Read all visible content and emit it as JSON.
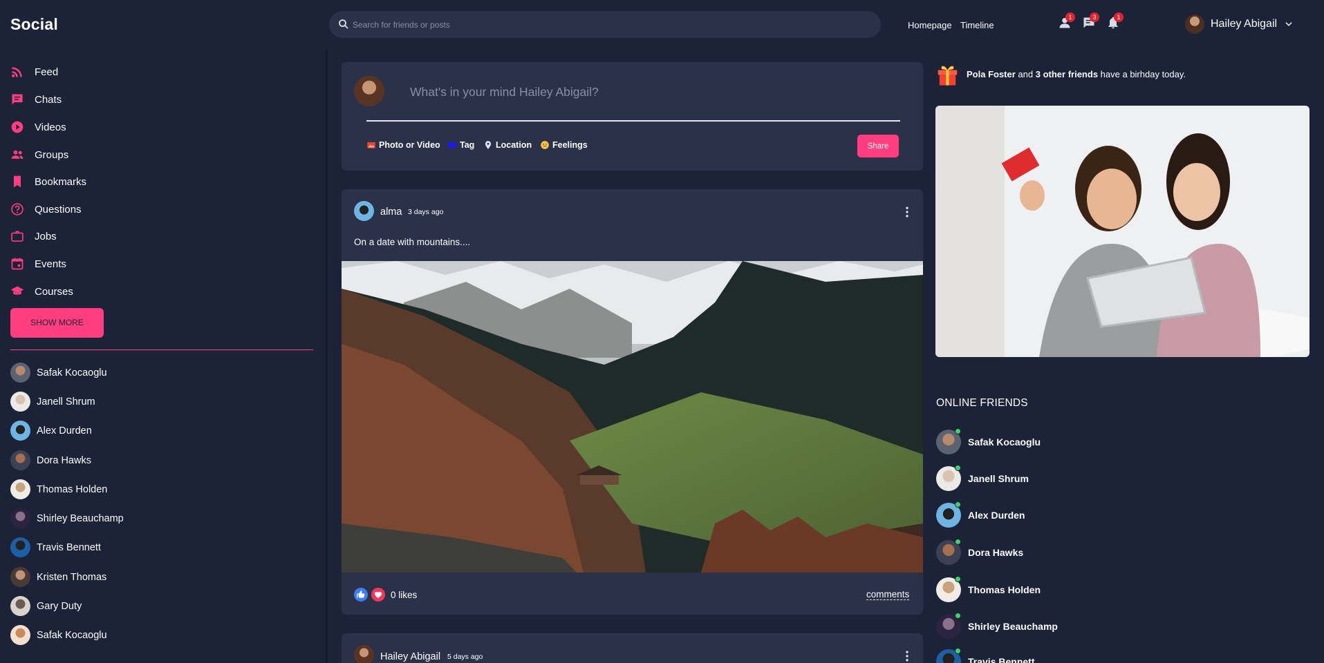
{
  "app": {
    "logo": "Social"
  },
  "search": {
    "placeholder": "Search for friends or posts"
  },
  "topnav": {
    "links": [
      "Homepage",
      "Timeline"
    ]
  },
  "notifications": {
    "friend_requests": "1",
    "messages": "3",
    "alerts": "1"
  },
  "profile": {
    "name": "Hailey Abigail"
  },
  "sidebar": {
    "items": [
      {
        "label": "Feed",
        "icon": "rss-icon"
      },
      {
        "label": "Chats",
        "icon": "chat-icon"
      },
      {
        "label": "Videos",
        "icon": "play-circle-icon"
      },
      {
        "label": "Groups",
        "icon": "group-icon"
      },
      {
        "label": "Bookmarks",
        "icon": "bookmark-icon"
      },
      {
        "label": "Questions",
        "icon": "help-circle-icon"
      },
      {
        "label": "Jobs",
        "icon": "briefcase-icon"
      },
      {
        "label": "Events",
        "icon": "calendar-icon"
      },
      {
        "label": "Courses",
        "icon": "graduation-cap-icon"
      }
    ],
    "show_more_label": "SHOW MORE",
    "friends": [
      "Safak Kocaoglu",
      "Janell Shrum",
      "Alex Durden",
      "Dora Hawks",
      "Thomas Holden",
      "Shirley Beauchamp",
      "Travis Bennett",
      "Kristen Thomas",
      "Gary Duty",
      "Safak Kocaoglu"
    ]
  },
  "composer": {
    "prompt": "What's in your mind Hailey Abigail?",
    "options": [
      "Photo or Video",
      "Tag",
      "Location",
      "Feelings"
    ],
    "share_label": "Share"
  },
  "posts": [
    {
      "author": "alma",
      "time": "3 days ago",
      "text": "On a date with mountains....",
      "likes": "0 likes",
      "comments_label": "comments"
    },
    {
      "author": "Hailey Abigail",
      "time": "5 days ago"
    }
  ],
  "birthday": {
    "name": "Pola Foster",
    "and": "and",
    "others": "3 other friends",
    "suffix": "have a birhday today."
  },
  "online": {
    "title": "ONLINE FRIENDS",
    "friends": [
      "Safak Kocaoglu",
      "Janell Shrum",
      "Alex Durden",
      "Dora Hawks",
      "Thomas Holden",
      "Shirley Beauchamp",
      "Travis Bennett"
    ]
  },
  "colors": {
    "accent": "#ff3d7f",
    "background": "#1c2237",
    "card": "#2a3149",
    "online": "#3fd16a",
    "badge": "#e0242e"
  }
}
